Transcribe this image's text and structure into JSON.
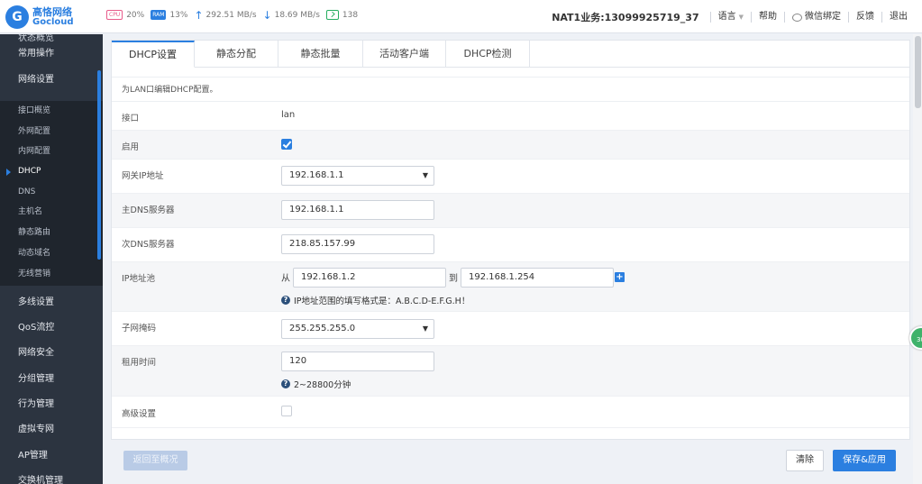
{
  "brand": {
    "mark": "G",
    "name_cn": "高恪网络",
    "name_en": "Gocloud"
  },
  "stats": {
    "cpu_label": "CPU",
    "cpu": "20%",
    "ram_label": "RAM",
    "ram": "13%",
    "upload": "292.51 MB/s",
    "download": "18.69 MB/s",
    "terminals": "138"
  },
  "header": {
    "account": "NAT1业务:13099925719_37",
    "language": "语言",
    "help": "帮助",
    "wechat": "微信绑定",
    "feedback": "反馈",
    "logout": "退出"
  },
  "sidebar": {
    "cut_label": "状态概览",
    "menus_top": [
      "常用操作",
      "网络设置"
    ],
    "sub_items": [
      "接口概览",
      "外网配置",
      "内网配置",
      "DHCP",
      "DNS",
      "主机名",
      "静态路由",
      "动态域名",
      "无线营销"
    ],
    "menus_bottom": [
      "多线设置",
      "QoS流控",
      "网络安全",
      "分组管理",
      "行为管理",
      "虚拟专网",
      "AP管理",
      "交换机管理"
    ]
  },
  "tabs": [
    "DHCP设置",
    "静态分配",
    "静态批量",
    "活动客户端",
    "DHCP检测"
  ],
  "description": "为LAN口编辑DHCP配置。",
  "form": {
    "interface_label": "接口",
    "interface_value": "lan",
    "enable_label": "启用",
    "gateway_label": "网关IP地址",
    "gateway_value": "192.168.1.1",
    "dns1_label": "主DNS服务器",
    "dns1_value": "192.168.1.1",
    "dns2_label": "次DNS服务器",
    "dns2_value": "218.85.157.99",
    "pool_label": "IP地址池",
    "pool_from_word": "从",
    "pool_from": "192.168.1.2",
    "pool_to_word": "到",
    "pool_to": "192.168.1.254",
    "pool_hint": "IP地址范围的填写格式是：A.B.C.D-E.F.G.H！",
    "mask_label": "子网掩码",
    "mask_value": "255.255.255.0",
    "lease_label": "租用时间",
    "lease_value": "120",
    "lease_hint": "2~28800分钟",
    "advanced_label": "高级设置"
  },
  "buttons": {
    "back": "返回至概况",
    "clear": "清除",
    "save": "保存&应用"
  },
  "float_badge": "30",
  "colors": {
    "accent": "#2b7fe0",
    "sidebar": "#2c3440",
    "terminal": "#27ae60"
  }
}
